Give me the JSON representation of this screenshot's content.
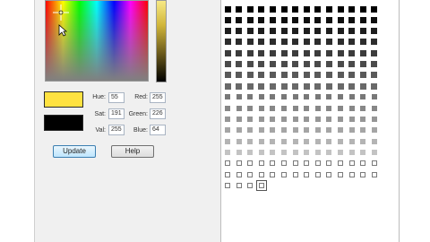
{
  "fields": {
    "hue": {
      "label": "Hue:",
      "value": "55"
    },
    "sat": {
      "label": "Sat:",
      "value": "191"
    },
    "val": {
      "label": "Val:",
      "value": "255"
    },
    "red": {
      "label": "Red:",
      "value": "255"
    },
    "green": {
      "label": "Green:",
      "value": "226"
    },
    "blue": {
      "label": "Blue:",
      "value": "64"
    }
  },
  "buttons": {
    "update": "Update",
    "help": "Help"
  },
  "swatches": {
    "new_color": "#ffe241",
    "old_color": "#000000"
  },
  "palette": {
    "rows": 17,
    "cols": 14,
    "visible_rows": [
      14,
      14,
      14,
      14,
      14,
      14,
      14,
      14,
      14,
      14,
      14,
      14,
      14,
      14,
      14,
      14,
      4
    ],
    "selected_row": 16,
    "selected_col": 3
  }
}
